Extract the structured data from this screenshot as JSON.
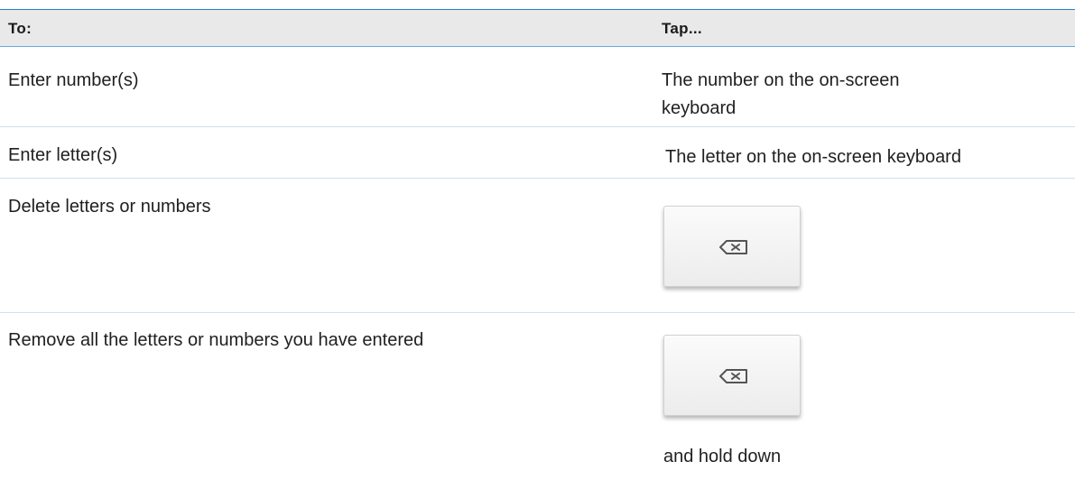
{
  "table": {
    "headers": {
      "to": "To:",
      "tap": "Tap..."
    },
    "rows": [
      {
        "action": "Enter number(s)",
        "tap_line1": "The number on the on-screen",
        "tap_line2": "keyboard"
      },
      {
        "action": "Enter letter(s)",
        "tap": "The letter on the on-screen keyboard"
      },
      {
        "action": "Delete letters or numbers",
        "tap_icon": "backspace-icon"
      },
      {
        "action": "Remove all the letters or numbers you have entered",
        "tap_icon": "backspace-icon",
        "tap_note": "and hold down"
      }
    ]
  }
}
